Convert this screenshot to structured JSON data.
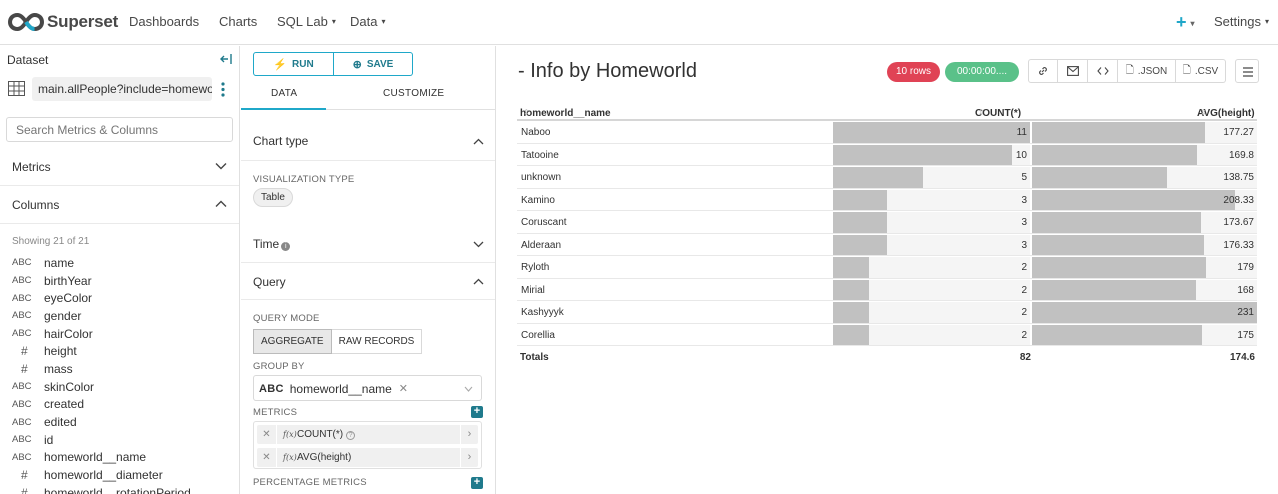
{
  "nav": {
    "brand": "Superset",
    "items": [
      {
        "label": "Dashboards"
      },
      {
        "label": "Charts"
      },
      {
        "label": "SQL Lab"
      },
      {
        "label": "Data"
      }
    ],
    "plus": "+",
    "settings": "Settings",
    "caret": "▾"
  },
  "dataset": {
    "title": "Dataset",
    "name": "main.allPeople?include=homeworld",
    "search_placeholder": "Search Metrics & Columns",
    "metrics_label": "Metrics",
    "columns_label": "Columns",
    "showing": "Showing 21 of 21",
    "columns": [
      {
        "type": "ABC",
        "name": "name"
      },
      {
        "type": "ABC",
        "name": "birthYear"
      },
      {
        "type": "ABC",
        "name": "eyeColor"
      },
      {
        "type": "ABC",
        "name": "gender"
      },
      {
        "type": "ABC",
        "name": "hairColor"
      },
      {
        "type": "#",
        "name": "height"
      },
      {
        "type": "#",
        "name": "mass"
      },
      {
        "type": "ABC",
        "name": "skinColor"
      },
      {
        "type": "ABC",
        "name": "created"
      },
      {
        "type": "ABC",
        "name": "edited"
      },
      {
        "type": "ABC",
        "name": "id"
      },
      {
        "type": "ABC",
        "name": "homeworld__name"
      },
      {
        "type": "#",
        "name": "homeworld__diameter"
      },
      {
        "type": "#",
        "name": "homeworld__rotationPeriod"
      }
    ]
  },
  "control": {
    "run": "RUN",
    "save": "SAVE",
    "tab_data": "DATA",
    "tab_customize": "CUSTOMIZE",
    "chart_type": "Chart type",
    "viz_type_label": "VISUALIZATION TYPE",
    "viz_type": "Table",
    "time": "Time",
    "query": "Query",
    "query_mode_label": "QUERY MODE",
    "mode_aggregate": "AGGREGATE",
    "mode_raw": "RAW RECORDS",
    "group_by_label": "GROUP BY",
    "group_by_type": "ABC",
    "group_by_value": "homeworld__name",
    "metrics_label": "METRICS",
    "metrics": [
      {
        "label": "COUNT(*)"
      },
      {
        "label": "AVG(height)"
      }
    ],
    "percentage_metrics_label": "PERCENTAGE METRICS"
  },
  "results": {
    "title": "- Info by Homeworld",
    "rows_badge": "10 rows",
    "time_badge": "00:00:00....",
    "json": ".JSON",
    "csv": ".CSV",
    "columns": [
      "homeworld__name",
      "COUNT(*)",
      "AVG(height)"
    ],
    "rows": [
      {
        "name": "Naboo",
        "count": "11",
        "avg": "177.27"
      },
      {
        "name": "Tatooine",
        "count": "10",
        "avg": "169.8"
      },
      {
        "name": "unknown",
        "count": "5",
        "avg": "138.75"
      },
      {
        "name": "Kamino",
        "count": "3",
        "avg": "208.33"
      },
      {
        "name": "Coruscant",
        "count": "3",
        "avg": "173.67"
      },
      {
        "name": "Alderaan",
        "count": "3",
        "avg": "176.33"
      },
      {
        "name": "Ryloth",
        "count": "2",
        "avg": "179"
      },
      {
        "name": "Mirial",
        "count": "2",
        "avg": "168"
      },
      {
        "name": "Kashyyyk",
        "count": "2",
        "avg": "231"
      },
      {
        "name": "Corellia",
        "count": "2",
        "avg": "175"
      }
    ],
    "totals_label": "Totals",
    "total_count": "82",
    "total_avg": "174.6"
  },
  "colors": {
    "accent": "#1fa8c9",
    "rows_badge": "#e04355",
    "time_badge": "#5ac189",
    "bar": "#c1c1c1"
  }
}
